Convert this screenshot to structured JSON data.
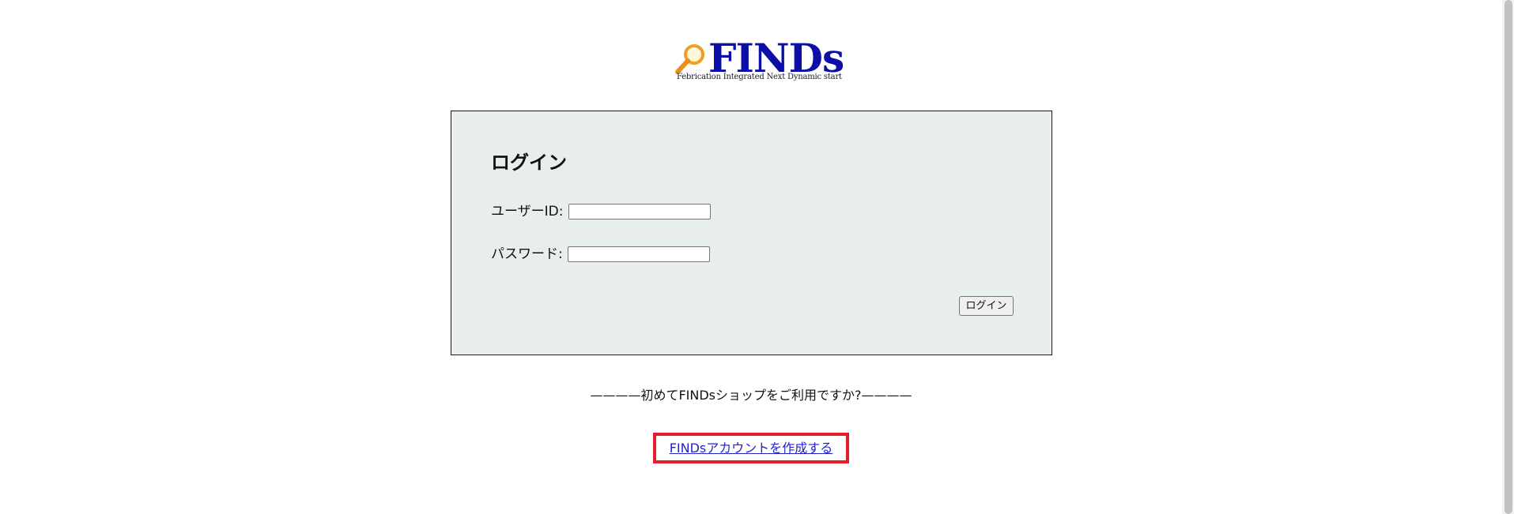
{
  "logo": {
    "title": "FINDs",
    "subtitle": "Febrication Integrated Next Dynamic start",
    "icon": "magnifier-icon",
    "brand_color": "#0b0fa8",
    "icon_color": "#f0a020"
  },
  "login": {
    "title": "ログイン",
    "user_id_label": "ユーザーID:",
    "user_id_value": "",
    "password_label": "パスワード:",
    "password_value": "",
    "button_label": "ログイン",
    "background_color": "#e8eeee"
  },
  "signup": {
    "prompt": "————初めてFINDsショップをご利用ですか?————",
    "link_label": "FINDsアカウントを作成する",
    "highlight_color": "#e0202a"
  },
  "scrollbar": {
    "visible": true
  }
}
